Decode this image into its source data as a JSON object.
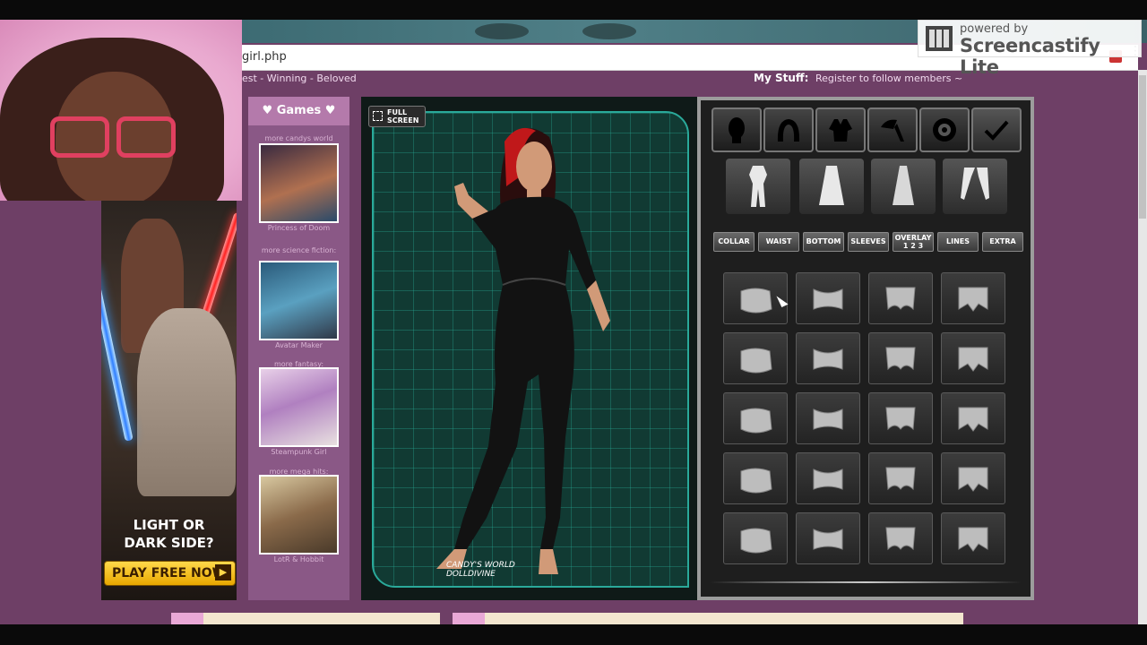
{
  "browser": {
    "url_fragment": "girl.php"
  },
  "watermark": {
    "line1": "powered by",
    "line2": "Screencastify Lite"
  },
  "site_nav": {
    "links_text": "est  -  Winning  -  Beloved",
    "my_stuff_label": "My Stuff:",
    "register_text": "Register to follow members ~"
  },
  "ad": {
    "tagline_line1": "LIGHT OR",
    "tagline_line2": "DARK SIDE?",
    "cta": "PLAY FREE NOW"
  },
  "games_sidebar": {
    "header": "♥ Games ♥",
    "items": [
      {
        "caption": "more candys world",
        "name": "Princess of Doom"
      },
      {
        "caption": "more science fiction:",
        "name": "Avatar Maker"
      },
      {
        "caption": "more fantasy:",
        "name": "Steampunk Girl"
      },
      {
        "caption": "more mega hits:",
        "name": "LotR & Hobbit"
      }
    ]
  },
  "stage": {
    "fullscreen_line1": "FULL",
    "fullscreen_line2": "SCREEN",
    "credit_line1": "CANDY'S WORLD",
    "credit_line2": "DOLLDIVINE"
  },
  "tool_panel": {
    "categories": [
      "head-icon",
      "hair-icon",
      "outfit-icon",
      "accessories-icon",
      "makeup-icon",
      "check-icon"
    ],
    "subcategories": [
      "bodysuit-icon",
      "dress-icon",
      "cape-icon",
      "sleeves-icon"
    ],
    "tabs": [
      "COLLAR",
      "WAIST",
      "BOTTOM",
      "SLEEVES",
      "OVERLAY",
      "LINES",
      "EXTRA"
    ],
    "overlay_numbers": "1  2  3",
    "swatch_rows": 5,
    "swatch_cols": 4
  },
  "colors": {
    "accent_teal": "#2aa99a",
    "page_bg": "#6e3f66",
    "games_header": "#b47aab"
  }
}
